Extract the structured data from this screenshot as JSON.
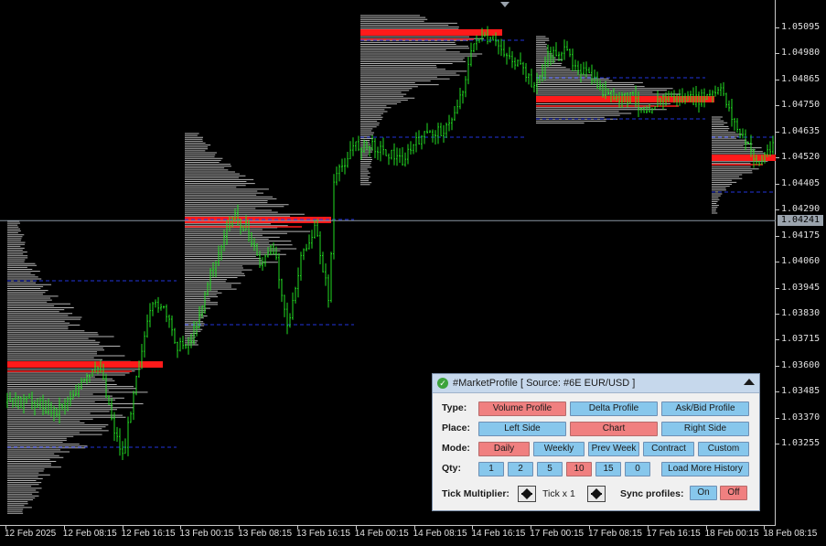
{
  "chart": {
    "symbol": "#6E EUR/USD",
    "current_price": "1.04241",
    "colors": {
      "candles": "#22dd22",
      "profile": "#b4b4b4",
      "poc": "#ff1a1a",
      "value_area": "#2233dd",
      "price_line": "#8a96a3"
    },
    "price_labels": [
      "1.05095",
      "1.04980",
      "1.04865",
      "1.04750",
      "1.04635",
      "1.04520",
      "1.04405",
      "1.04290",
      "1.04175",
      "1.04060",
      "1.03945",
      "1.03830",
      "1.03715",
      "1.03600",
      "1.03485",
      "1.03370",
      "1.03255"
    ],
    "time_labels": [
      "12 Feb 2025",
      "12 Feb 08:15",
      "12 Feb 16:15",
      "13 Feb 00:15",
      "13 Feb 08:15",
      "13 Feb 16:15",
      "14 Feb 00:15",
      "14 Feb 08:15",
      "14 Feb 16:15",
      "17 Feb 00:15",
      "17 Feb 08:15",
      "17 Feb 16:15",
      "18 Feb 00:15",
      "18 Feb 08:15"
    ]
  },
  "panel": {
    "title": "#MarketProfile [ Source: #6E EUR/USD ]",
    "type_label": "Type:",
    "type_buttons": [
      "Volume Profile",
      "Delta Profile",
      "Ask/Bid Profile"
    ],
    "place_label": "Place:",
    "place_buttons": [
      "Left Side",
      "Chart",
      "Right Side"
    ],
    "mode_label": "Mode:",
    "mode_buttons": [
      "Daily",
      "Weekly",
      "Prev Week",
      "Contract",
      "Custom"
    ],
    "qty_label": "Qty:",
    "qty_buttons": [
      "1",
      "2",
      "5",
      "10",
      "15",
      "0"
    ],
    "load_more": "Load More History",
    "tick_label": "Tick Multiplier:",
    "tick_value": "Tick x 1",
    "sync_label": "Sync profiles:",
    "sync_on": "On",
    "sync_off": "Off",
    "active": {
      "type": "Volume Profile",
      "place": "Chart",
      "mode": "Daily",
      "qty": "10",
      "sync": "Off"
    }
  }
}
